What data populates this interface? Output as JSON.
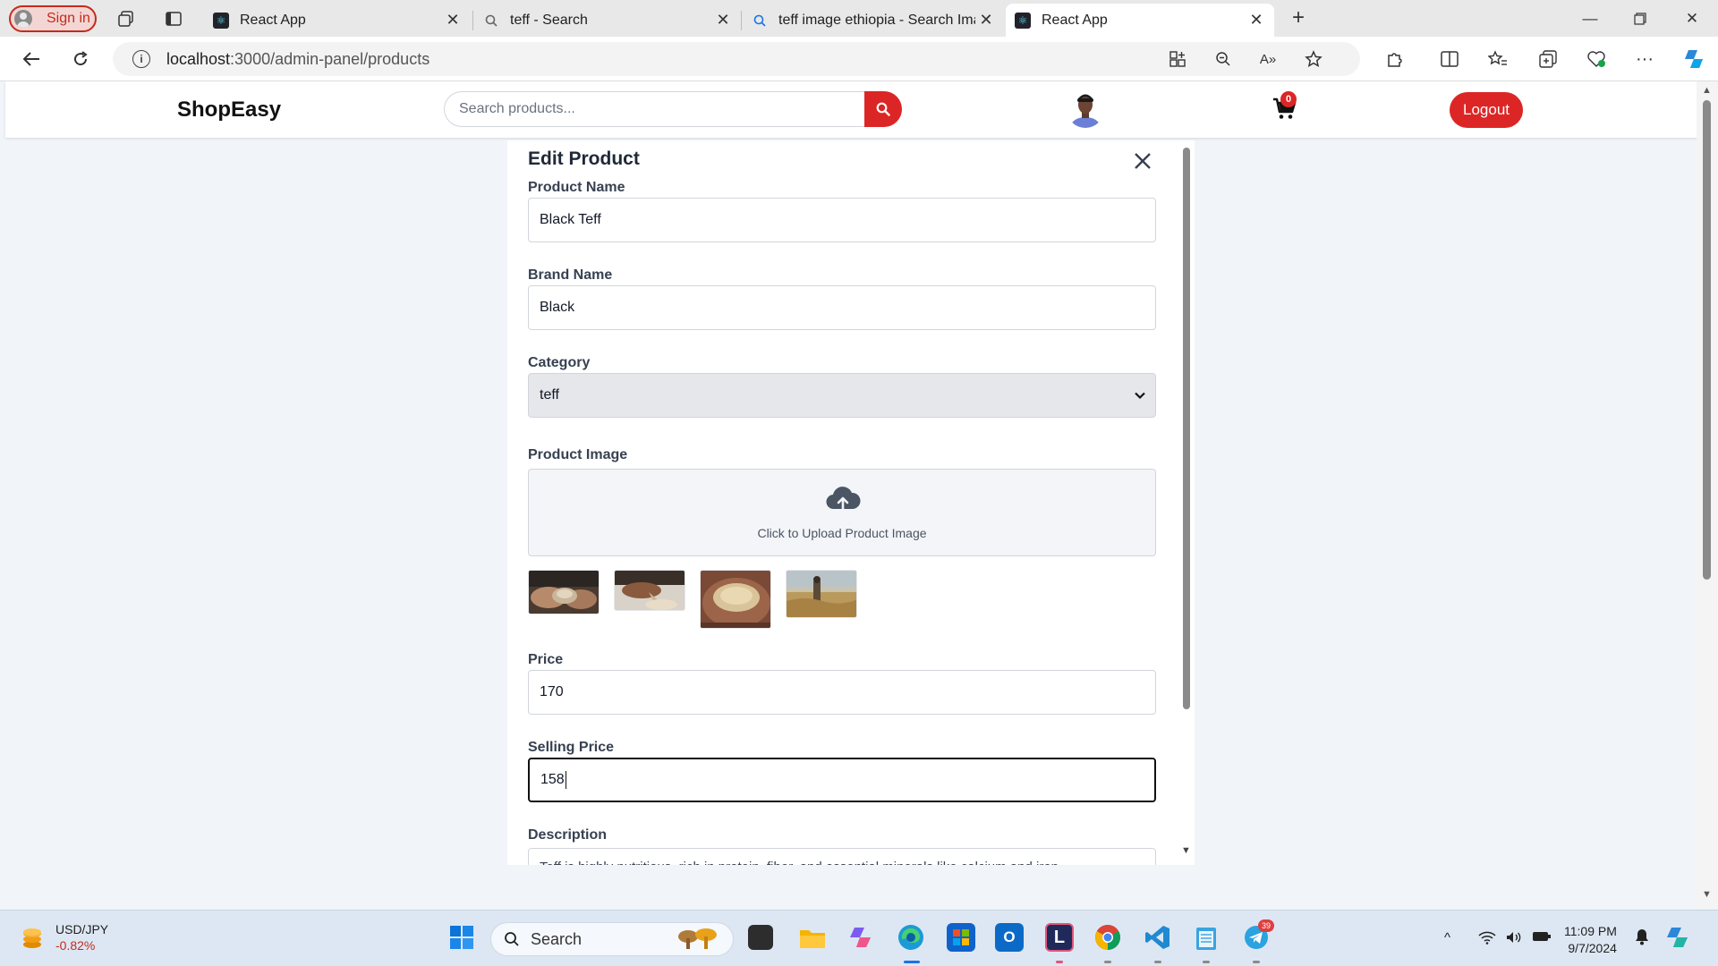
{
  "browser": {
    "signin_label": "Sign in",
    "tabs": [
      {
        "title": "React App",
        "active": false
      },
      {
        "title": "teff - Search",
        "active": false
      },
      {
        "title": "teff image ethiopia - Search Imag",
        "active": false
      },
      {
        "title": "React App",
        "active": true
      }
    ],
    "url_host": "localhost",
    "url_path": ":3000/admin-panel/products"
  },
  "header": {
    "logo": "ShopEasy",
    "search_placeholder": "Search products...",
    "cart_count": "0",
    "logout_label": "Logout"
  },
  "modal": {
    "title": "Edit Product",
    "product_name_label": "Product Name",
    "product_name_value": "Black Teff",
    "brand_name_label": "Brand Name",
    "brand_name_value": "Black",
    "category_label": "Category",
    "category_value": "teff",
    "product_image_label": "Product Image",
    "upload_text": "Click to Upload Product Image",
    "images": [
      "teff-hands-photo",
      "teff-pour-photo",
      "teff-grain-palm-photo",
      "teff-field-photo"
    ],
    "price_label": "Price",
    "price_value": "170",
    "selling_price_label": "Selling Price",
    "selling_price_value": "158",
    "description_label": "Description",
    "description_value": "Teff is highly nutritious, rich in protein, fiber, and essential minerals like calcium and iron"
  },
  "taskbar": {
    "widget_pair": "USD/JPY",
    "widget_change": "-0.82%",
    "search_label": "Search",
    "telegram_badge": "39",
    "time": "11:09 PM",
    "date": "9/7/2024"
  },
  "colors": {
    "accent_red": "#dc2626",
    "page_bg": "#f1f5f9"
  }
}
